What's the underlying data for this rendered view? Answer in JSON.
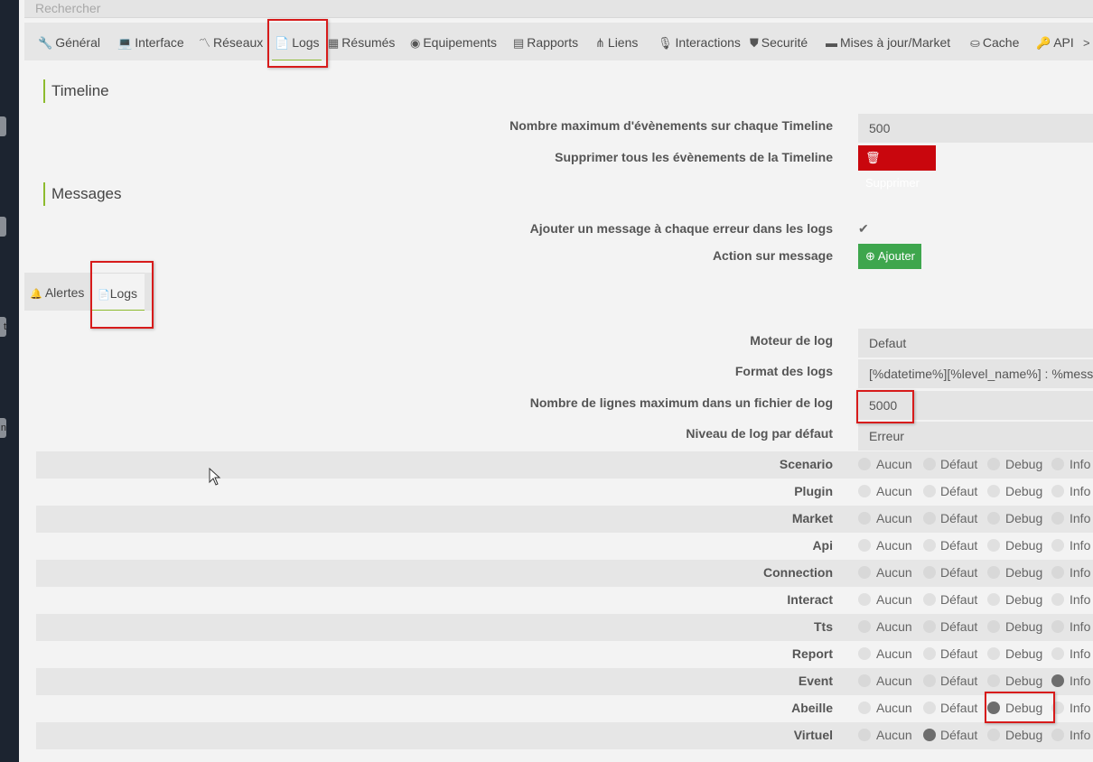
{
  "search": {
    "placeholder": "Rechercher"
  },
  "strip_tabs": [
    "",
    "",
    "t",
    "n"
  ],
  "tabs": [
    {
      "label": "Général",
      "icon": "wrench-icon",
      "glyph": "🔧"
    },
    {
      "label": "Interface",
      "icon": "laptop-icon",
      "glyph": "💻"
    },
    {
      "label": "Réseaux",
      "icon": "rss-icon",
      "glyph": "〽"
    },
    {
      "label": "Logs",
      "icon": "file-icon",
      "glyph": "📄"
    },
    {
      "label": "Résumés",
      "icon": "table-icon",
      "glyph": "▦"
    },
    {
      "label": "Equipements",
      "icon": "devices-icon",
      "glyph": "◉"
    },
    {
      "label": "Rapports",
      "icon": "report-icon",
      "glyph": "▤"
    },
    {
      "label": "Liens",
      "icon": "sitemap-icon",
      "glyph": "⋔"
    },
    {
      "label": "Interactions",
      "icon": "microphone-icon",
      "glyph": "🎙"
    },
    {
      "label": "Securité",
      "icon": "shield-icon",
      "glyph": "⛊"
    },
    {
      "label": "Mises à jour/Market",
      "icon": "credit-card-icon",
      "glyph": "▬"
    },
    {
      "label": "Cache",
      "icon": "hdd-icon",
      "glyph": "⛀"
    },
    {
      "label": "API",
      "icon": "key-icon",
      "glyph": "🔑"
    },
    {
      "label": "",
      "icon": "terminal-icon",
      "glyph": ">"
    }
  ],
  "timeline": {
    "title": "Timeline",
    "max_events_label": "Nombre maximum d'évènements sur chaque Timeline",
    "max_events_value": "500",
    "delete_label": "Supprimer tous les évènements de la Timeline",
    "delete_button": "Supprimer"
  },
  "messages": {
    "title": "Messages",
    "add_message_label": "Ajouter un message à chaque erreur dans les logs",
    "add_message_checked": true,
    "action_label": "Action sur message",
    "add_button": "Ajouter"
  },
  "subtabs": [
    {
      "label": "Alertes",
      "icon": "bell-icon",
      "glyph": "🔔"
    },
    {
      "label": "Logs",
      "icon": "file-icon",
      "glyph": "📄"
    }
  ],
  "log_settings": {
    "engine_label": "Moteur de log",
    "engine_value": "Defaut",
    "format_label": "Format des logs",
    "format_value": "[%datetime%][%level_name%] : %message%",
    "max_lines_label": "Nombre de lignes maximum dans un fichier de log",
    "max_lines_value": "5000",
    "default_level_label": "Niveau de log par défaut",
    "default_level_value": "Erreur"
  },
  "levels": [
    "Aucun",
    "Défaut",
    "Debug",
    "Info"
  ],
  "log_rows": [
    {
      "name": "Scenario",
      "selected": null
    },
    {
      "name": "Plugin",
      "selected": null
    },
    {
      "name": "Market",
      "selected": null
    },
    {
      "name": "Api",
      "selected": null
    },
    {
      "name": "Connection",
      "selected": null
    },
    {
      "name": "Interact",
      "selected": null
    },
    {
      "name": "Tts",
      "selected": null
    },
    {
      "name": "Report",
      "selected": null
    },
    {
      "name": "Event",
      "selected": "Info"
    },
    {
      "name": "Abeille",
      "selected": "Debug"
    },
    {
      "name": "Virtuel",
      "selected": "Défaut"
    }
  ],
  "colors": {
    "accent": "#8dbb2e",
    "danger": "#c9060d",
    "success": "#3ea64d",
    "highlight": "#d71b1b"
  }
}
